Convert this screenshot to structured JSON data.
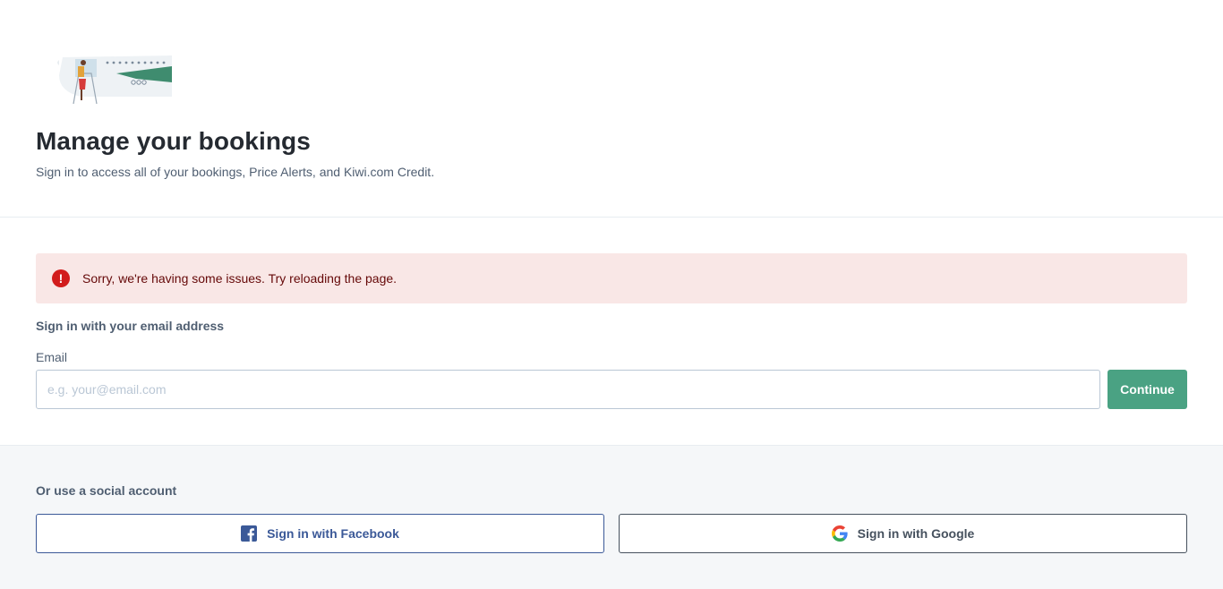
{
  "hero": {
    "title": "Manage your bookings",
    "subtitle": "Sign in to access all of your bookings, Price Alerts, and Kiwi.com Credit."
  },
  "alert": {
    "icon": "exclamation-icon",
    "message": "Sorry, we're having some issues. Try reloading the page.",
    "color": "#d21c1c"
  },
  "email_form": {
    "heading": "Sign in with your email address",
    "label": "Email",
    "value": "",
    "placeholder": "e.g. your@email.com",
    "submit_label": "Continue",
    "accent": "#4aa283"
  },
  "social": {
    "heading": "Or use a social account",
    "facebook_label": "Sign in with Facebook",
    "google_label": "Sign in with Google",
    "facebook_color": "#3b5998"
  }
}
